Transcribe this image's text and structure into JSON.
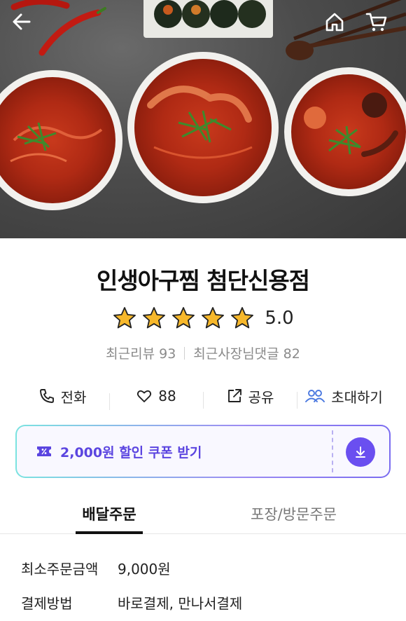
{
  "nav": {
    "back_icon": "arrow-left-icon",
    "home_icon": "home-icon",
    "cart_icon": "cart-icon"
  },
  "hero": {
    "image": "food-photo-spicy-seafood-dishes"
  },
  "store": {
    "name": "인생아구찜 첨단신용점",
    "rating_stars": 5,
    "rating_value": "5.0",
    "recent_reviews_label": "최근리뷰 93",
    "recent_owner_replies_label": "최근사장님댓글 82"
  },
  "actions": {
    "call_label": "전화",
    "like_count": "88",
    "share_label": "공유",
    "invite_label": "초대하기"
  },
  "coupon": {
    "label": "2,000원 할인 쿠폰 받기",
    "accent_color": "#5b45e0",
    "download_icon": "download-icon"
  },
  "tabs": {
    "delivery": "배달주문",
    "pickup": "포장/방문주문"
  },
  "info": {
    "min_order_label": "최소주문금액",
    "min_order_value": "9,000원",
    "payment_label": "결제방법",
    "payment_value": "바로결제, 만나서결제"
  }
}
